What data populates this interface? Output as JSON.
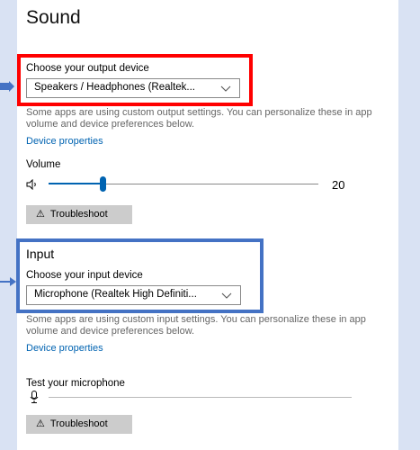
{
  "page": {
    "title": "Sound"
  },
  "output": {
    "label": "Choose your output device",
    "selected": "Speakers / Headphones (Realtek...",
    "description": "Some apps are using custom output settings. You can personalize these in app volume and device preferences below.",
    "device_properties": "Device properties",
    "volume_label": "Volume",
    "volume_value": "20",
    "volume_fraction": 0.2,
    "troubleshoot": "Troubleshoot"
  },
  "input": {
    "section_title": "Input",
    "label": "Choose your input device",
    "selected": "Microphone (Realtek High Definiti...",
    "description": "Some apps are using custom input settings. You can personalize these in app volume and device preferences below.",
    "device_properties": "Device properties",
    "test_label": "Test your microphone",
    "troubleshoot": "Troubleshoot"
  },
  "colors": {
    "accent": "#0063b1",
    "highlight_output": "#ff0000",
    "highlight_input": "#4472c4",
    "background": "#d9e2f3"
  },
  "icons": {
    "speaker": "speaker-icon",
    "microphone": "microphone-icon",
    "warning": "warning-icon",
    "chevron": "chevron-down-icon"
  }
}
